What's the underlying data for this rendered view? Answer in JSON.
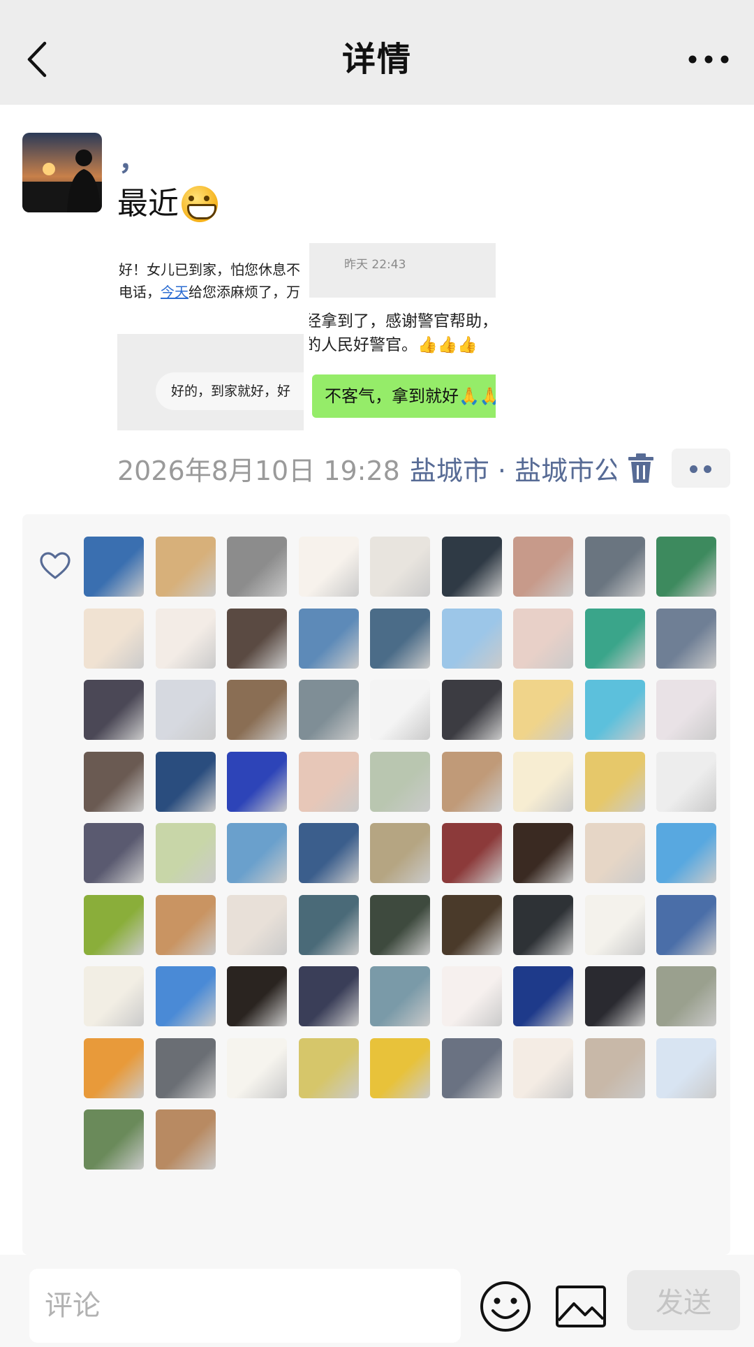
{
  "nav": {
    "title": "详情",
    "back_icon": "chevron-left-icon",
    "more_icon": "more-horizontal-icon"
  },
  "post": {
    "nickname": "，",
    "text": "最近",
    "emoji": "grinning-face-emoji",
    "images": [
      {
        "lines": [
          "好！女儿已到家，怕您休息不",
          "电话，",
          "今天",
          "给您添麻烦了，万"
        ],
        "bubble": "好的，到家就好，好"
      },
      {
        "time": "昨天 22:43",
        "lines": [
          "经拿到了，感谢警官帮助，",
          "的人民好警官。👍👍👍"
        ],
        "green_bubble": "不客气，拿到就好🙏🙏"
      }
    ],
    "timestamp": "2026年8月10日 19:28",
    "location": "盐城市 · 盐城市公安局"
  },
  "likes": {
    "icon": "heart-outline-icon",
    "count": 74,
    "colors": [
      "#3a6fb0",
      "#d7b07a",
      "#8c8c8c",
      "#f7f2ec",
      "#e8e4de",
      "#2f3a45",
      "#c79a8a",
      "#6a7580",
      "#3d8a5e",
      "#f0e2d2",
      "#f3ece6",
      "#5a4a42",
      "#5d8ab8",
      "#4b6c88",
      "#9cc6e8",
      "#e8d0c8",
      "#3aa58a",
      "#6f7f95",
      "#4b4856",
      "#d6d9e0",
      "#8a6e54",
      "#7f8e96",
      "#f4f4f4",
      "#3c3c42",
      "#f0d48a",
      "#5cc0dc",
      "#e9e2e6",
      "#6a5a52",
      "#2a4d7e",
      "#2d44b8",
      "#e7c7b8",
      "#b9c6b0",
      "#c09a78",
      "#f7edd2",
      "#e6c86a",
      "#ededed",
      "#5a5a70",
      "#c8d6a8",
      "#6aa0cc",
      "#3b5e8c",
      "#b5a582",
      "#8c3a3a",
      "#3a2a22",
      "#e6d6c6",
      "#58a8e0",
      "#8aae3a",
      "#c99462",
      "#e8e0d8",
      "#4a6a78",
      "#3e4a3e",
      "#4a3a2a",
      "#2e3236",
      "#f4f2ec",
      "#4a6ea8",
      "#f2eee4",
      "#4a8ad6",
      "#2a2420",
      "#3a3e58",
      "#7a9aa8",
      "#f6f0ee",
      "#1e3a8a",
      "#2a2a30",
      "#9aa08e",
      "#e89a3a",
      "#6a6e74",
      "#f6f4ee",
      "#d6c66a",
      "#e8c23a",
      "#6a7282",
      "#f4ece4",
      "#c8b8a8",
      "#d8e4f2",
      "#6a8a5a",
      "#b88a62",
      "#2e3440",
      "#e6dcd6",
      "#d4c2b4",
      "#f4f4f4",
      "#e8dcd8",
      "#1a2438",
      "#4a3a2e",
      "#7a9a6a",
      "#c8d8f4"
    ]
  },
  "bottom_bar": {
    "comment_placeholder": "评论",
    "emoji_icon": "smiley-face-icon",
    "image_icon": "image-icon",
    "send_label": "发送"
  }
}
